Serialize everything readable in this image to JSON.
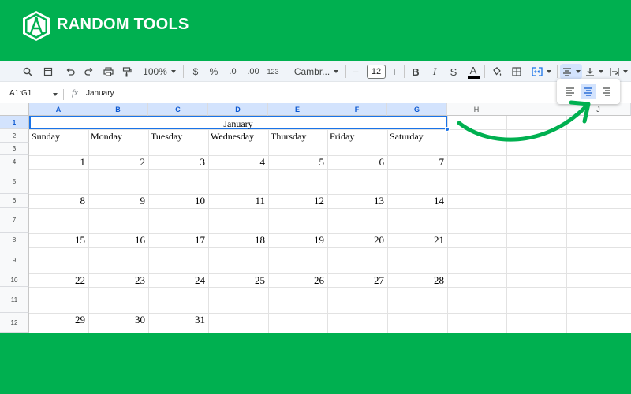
{
  "brand": {
    "name": "RANDOM TOOLS"
  },
  "toolbar": {
    "zoom": "100%",
    "currency": "$",
    "percent": "%",
    "decrease_decimal": ".0",
    "increase_decimal": ".00",
    "number_format": "123",
    "font_family": "Cambr...",
    "font_size": "12",
    "minus": "−",
    "plus": "+"
  },
  "formula_bar": {
    "namebox": "A1:G1",
    "fx": "fx",
    "value": "January"
  },
  "grid": {
    "columns": [
      "A",
      "B",
      "C",
      "D",
      "E",
      "F",
      "G",
      "H",
      "I",
      "J"
    ],
    "rows": [
      "1",
      "2",
      "3",
      "4",
      "5",
      "6",
      "7",
      "8",
      "9",
      "10",
      "11",
      "12"
    ],
    "month": "January",
    "weekdays": [
      "Sunday",
      "Monday",
      "Tuesday",
      "Wednesday",
      "Thursday",
      "Friday",
      "Saturday"
    ],
    "weeks": [
      [
        "1",
        "2",
        "3",
        "4",
        "5",
        "6",
        "7"
      ],
      [
        "8",
        "9",
        "10",
        "11",
        "12",
        "13",
        "14"
      ],
      [
        "15",
        "16",
        "17",
        "18",
        "19",
        "20",
        "21"
      ],
      [
        "22",
        "23",
        "24",
        "25",
        "26",
        "27",
        "28"
      ],
      [
        "29",
        "30",
        "31",
        "",
        "",
        "",
        ""
      ]
    ]
  },
  "colors": {
    "brand_green": "#00b050",
    "selection_blue": "#1a73e8",
    "header_selected": "#d3e3fd",
    "arrow_green": "#00b050"
  },
  "icons": [
    "search-icon",
    "menu-icon",
    "undo-icon",
    "redo-icon",
    "print-icon",
    "paint-format-icon",
    "bold-icon",
    "italic-icon",
    "strikethrough-icon",
    "text-color-icon",
    "fill-color-icon",
    "borders-icon",
    "merge-cells-icon",
    "horizontal-align-icon",
    "vertical-align-icon",
    "text-wrap-icon",
    "align-left-icon",
    "align-center-icon",
    "align-right-icon"
  ]
}
